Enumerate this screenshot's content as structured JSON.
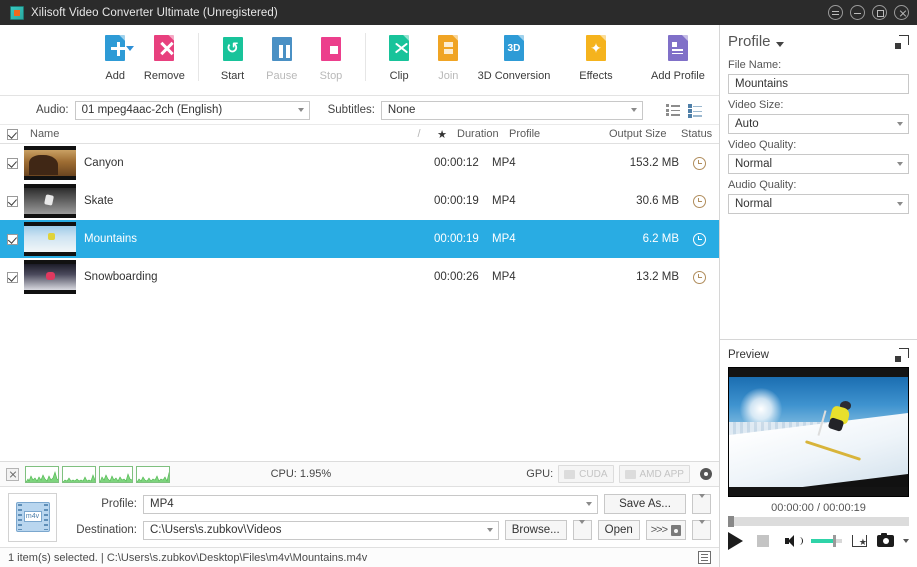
{
  "window": {
    "title": "Xilisoft Video Converter Ultimate (Unregistered)",
    "controls": {
      "menu": "menu-button",
      "minimize": "minimize",
      "maximize": "maximize",
      "close": "close"
    }
  },
  "toolbar": {
    "items": [
      {
        "label": "Add",
        "icon": "add-file-icon",
        "color": "#2e9bd6",
        "enabled": true,
        "dropdown": true
      },
      {
        "label": "Remove",
        "icon": "remove-file-icon",
        "color": "#e8407e",
        "enabled": true,
        "dropdown": false
      },
      {
        "label": "Start",
        "icon": "start-convert-icon",
        "color": "#18c39a",
        "enabled": true,
        "dropdown": false
      },
      {
        "label": "Pause",
        "icon": "pause-icon",
        "color": "#4a90c4",
        "enabled": false,
        "dropdown": false
      },
      {
        "label": "Stop",
        "icon": "stop-icon",
        "color": "#ec3f8c",
        "enabled": false,
        "dropdown": false
      },
      {
        "label": "Clip",
        "icon": "clip-scissors-icon",
        "color": "#18c39a",
        "enabled": true,
        "dropdown": false
      },
      {
        "label": "Join",
        "icon": "join-files-icon",
        "color": "#f0a424",
        "enabled": false,
        "dropdown": false
      },
      {
        "label": "3D Conversion",
        "icon": "3d-conversion-icon",
        "color": "#2e9bd6",
        "enabled": true,
        "dropdown": false
      },
      {
        "label": "Effects",
        "icon": "effects-wand-icon",
        "color": "#f5b31d",
        "enabled": true,
        "dropdown": false
      },
      {
        "label": "Add Profile",
        "icon": "add-profile-icon",
        "color": "#8070c8",
        "enabled": true,
        "dropdown": false
      }
    ],
    "3d_badge": "3D"
  },
  "optionsbar": {
    "audio_label": "Audio:",
    "audio_value": "01 mpeg4aac-2ch (English)",
    "subtitles_label": "Subtitles:",
    "subtitles_value": "None",
    "view_list_icon": "list-view-icon",
    "view_detail_icon": "detail-view-icon"
  },
  "filelist": {
    "columns": {
      "name": "Name",
      "slash": "/",
      "star": "★",
      "duration": "Duration",
      "profile": "Profile",
      "output_size": "Output Size",
      "status": "Status"
    },
    "header_checked": true,
    "rows": [
      {
        "name": "Canyon",
        "checked": true,
        "duration": "00:00:12",
        "profile": "MP4",
        "size": "153.2 MB",
        "status_icon": "clock-icon",
        "selected": false,
        "art": "canyon"
      },
      {
        "name": "Skate",
        "checked": true,
        "duration": "00:00:19",
        "profile": "MP4",
        "size": "30.6 MB",
        "status_icon": "clock-icon",
        "selected": false,
        "art": "skate"
      },
      {
        "name": "Mountains",
        "checked": true,
        "duration": "00:00:19",
        "profile": "MP4",
        "size": "6.2 MB",
        "status_icon": "clock-icon",
        "selected": true,
        "art": "mount"
      },
      {
        "name": "Snowboarding",
        "checked": true,
        "duration": "00:00:26",
        "profile": "MP4",
        "size": "13.2 MB",
        "status_icon": "clock-icon",
        "selected": false,
        "art": "snow"
      }
    ]
  },
  "cpubar": {
    "close_icon": "close-cpu-monitor-icon",
    "cpu_text": "CPU: 1.95%",
    "gpu_label": "GPU:",
    "cuda_label": "CUDA",
    "amd_label": "AMD APP",
    "settings_icon": "gear-icon",
    "core_count": 4
  },
  "output": {
    "film_icon": "film-strip-icon",
    "profile_label": "Profile:",
    "profile_value": "MP4",
    "destination_label": "Destination:",
    "destination_value": "C:\\Users\\s.zubkov\\Videos",
    "save_as_label": "Save As...",
    "browse_label": "Browse...",
    "open_label": "Open",
    "convert_label": ">>>"
  },
  "statusbar": {
    "text": "1 item(s) selected. | C:\\Users\\s.zubkov\\Desktop\\Files\\m4v\\Mountains.m4v",
    "right_icon": "log-panel-icon"
  },
  "profile_panel": {
    "title": "Profile",
    "expand_icon": "expand-icon",
    "file_name_label": "File Name:",
    "file_name_value": "Mountains",
    "video_size_label": "Video Size:",
    "video_size_value": "Auto",
    "video_quality_label": "Video Quality:",
    "video_quality_value": "Normal",
    "audio_quality_label": "Audio Quality:",
    "audio_quality_value": "Normal"
  },
  "preview_panel": {
    "title": "Preview",
    "expand_icon": "expand-icon",
    "time_text": "00:00:00 / 00:00:19",
    "play_icon": "play-icon",
    "stop_icon": "stop-icon",
    "volume_icon": "speaker-icon",
    "snapshot_folder_icon": "snapshot-favorite-icon",
    "camera_icon": "camera-snapshot-icon"
  },
  "colors": {
    "accent_blue": "#29ace3",
    "titlebar": "#2b2b2b",
    "green": "#2fd3a8"
  }
}
